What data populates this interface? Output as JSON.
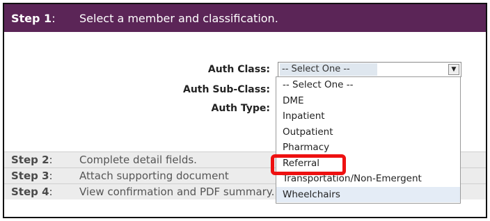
{
  "step1": {
    "number": "Step 1",
    "colon": ":",
    "title": "Select a member and classification."
  },
  "form": {
    "auth_class_label": "Auth Class:",
    "auth_subclass_label": "Auth Sub-Class:",
    "auth_type_label": "Auth Type:",
    "auth_class_value": "-- Select One --"
  },
  "dropdown_options": [
    "-- Select One --",
    "DME",
    "Inpatient",
    "Outpatient",
    "Pharmacy",
    "Referral",
    "Transportation/Non-Emergent",
    "Wheelchairs"
  ],
  "steps": [
    {
      "number": "Step 2",
      "colon": ":",
      "title": "Complete detail fields."
    },
    {
      "number": "Step 3",
      "colon": ":",
      "title": "Attach supporting document"
    },
    {
      "number": "Step 4",
      "colon": ":",
      "title": "View confirmation and PDF summary."
    }
  ],
  "colors": {
    "header_bg": "#5b2557",
    "highlight": "#ee1111",
    "hover_bg": "#e4ecf6"
  },
  "icons": {
    "select_arrow": "chevron-down-icon"
  }
}
